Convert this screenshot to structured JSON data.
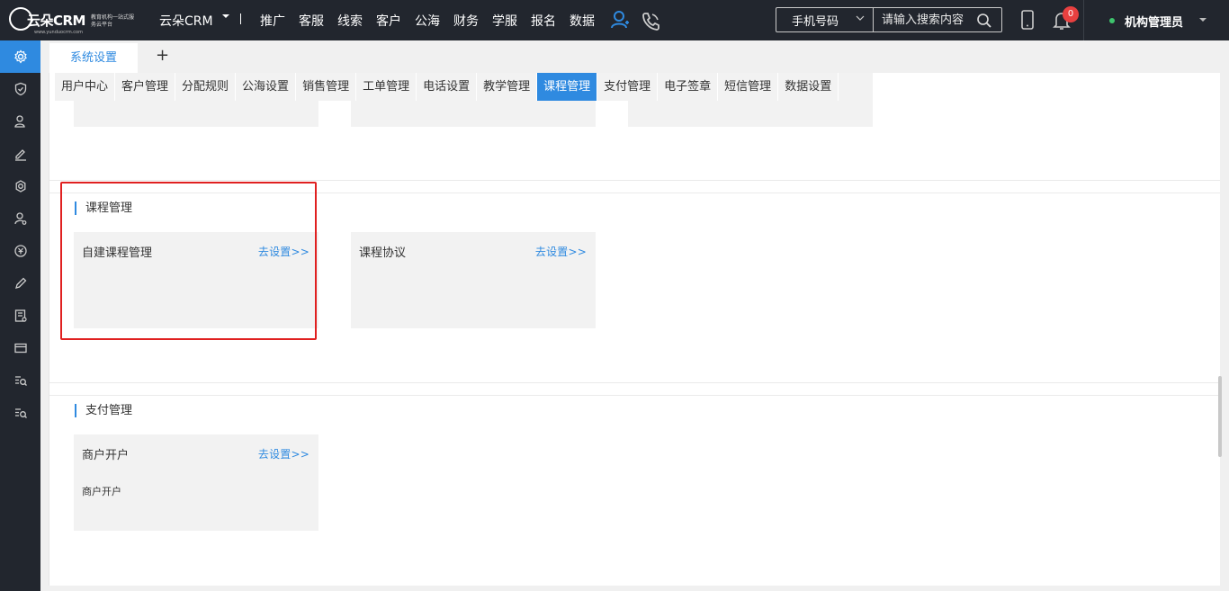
{
  "header": {
    "logo_text": "云朵CRM",
    "logo_slogan": "教育机构一站式服务云平台",
    "logo_url": "www.yunduocrm.com",
    "brand": "云朵CRM",
    "nav": [
      "推广",
      "客服",
      "线索",
      "客户",
      "公海",
      "财务",
      "学服",
      "报名",
      "数据"
    ],
    "search": {
      "select_label": "手机号码",
      "placeholder": "请输入搜索内容"
    },
    "notification_count": "0",
    "admin_name": "机构管理员"
  },
  "sidebar": {
    "items": [
      "settings-gear",
      "shield",
      "user",
      "edit",
      "gear",
      "user-settings",
      "finance",
      "pen",
      "form",
      "card",
      "search-list",
      "search-list-2"
    ],
    "active_index": 0
  },
  "tabs": {
    "page_tab": "系统设置",
    "add_label": "+"
  },
  "subtabs": {
    "items": [
      "用户中心",
      "客户管理",
      "分配规则",
      "公海设置",
      "销售管理",
      "工单管理",
      "电话设置",
      "教学管理",
      "课程管理",
      "支付管理",
      "电子签章",
      "短信管理",
      "数据设置"
    ],
    "active": "课程管理"
  },
  "sections": [
    {
      "title": "课程管理",
      "cards": [
        {
          "title": "自建课程管理",
          "link": "去设置>>",
          "desc": ""
        },
        {
          "title": "课程协议",
          "link": "去设置>>",
          "desc": ""
        }
      ]
    },
    {
      "title": "支付管理",
      "cards": [
        {
          "title": "商户开户",
          "link": "去设置>>",
          "desc": "商户开户"
        }
      ]
    }
  ],
  "colors": {
    "topbar": "#22262e",
    "accent": "#2f8ae0",
    "highlight": "#e02020",
    "badge": "#e84040"
  }
}
